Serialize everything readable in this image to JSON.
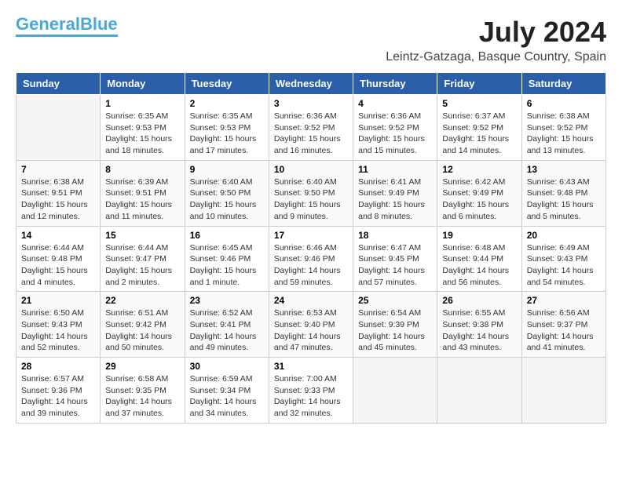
{
  "header": {
    "logo_line1": "General",
    "logo_line2": "Blue",
    "month_year": "July 2024",
    "location": "Leintz-Gatzaga, Basque Country, Spain"
  },
  "columns": [
    "Sunday",
    "Monday",
    "Tuesday",
    "Wednesday",
    "Thursday",
    "Friday",
    "Saturday"
  ],
  "weeks": [
    [
      {
        "day": "",
        "info": ""
      },
      {
        "day": "1",
        "info": "Sunrise: 6:35 AM\nSunset: 9:53 PM\nDaylight: 15 hours\nand 18 minutes."
      },
      {
        "day": "2",
        "info": "Sunrise: 6:35 AM\nSunset: 9:53 PM\nDaylight: 15 hours\nand 17 minutes."
      },
      {
        "day": "3",
        "info": "Sunrise: 6:36 AM\nSunset: 9:52 PM\nDaylight: 15 hours\nand 16 minutes."
      },
      {
        "day": "4",
        "info": "Sunrise: 6:36 AM\nSunset: 9:52 PM\nDaylight: 15 hours\nand 15 minutes."
      },
      {
        "day": "5",
        "info": "Sunrise: 6:37 AM\nSunset: 9:52 PM\nDaylight: 15 hours\nand 14 minutes."
      },
      {
        "day": "6",
        "info": "Sunrise: 6:38 AM\nSunset: 9:52 PM\nDaylight: 15 hours\nand 13 minutes."
      }
    ],
    [
      {
        "day": "7",
        "info": "Sunrise: 6:38 AM\nSunset: 9:51 PM\nDaylight: 15 hours\nand 12 minutes."
      },
      {
        "day": "8",
        "info": "Sunrise: 6:39 AM\nSunset: 9:51 PM\nDaylight: 15 hours\nand 11 minutes."
      },
      {
        "day": "9",
        "info": "Sunrise: 6:40 AM\nSunset: 9:50 PM\nDaylight: 15 hours\nand 10 minutes."
      },
      {
        "day": "10",
        "info": "Sunrise: 6:40 AM\nSunset: 9:50 PM\nDaylight: 15 hours\nand 9 minutes."
      },
      {
        "day": "11",
        "info": "Sunrise: 6:41 AM\nSunset: 9:49 PM\nDaylight: 15 hours\nand 8 minutes."
      },
      {
        "day": "12",
        "info": "Sunrise: 6:42 AM\nSunset: 9:49 PM\nDaylight: 15 hours\nand 6 minutes."
      },
      {
        "day": "13",
        "info": "Sunrise: 6:43 AM\nSunset: 9:48 PM\nDaylight: 15 hours\nand 5 minutes."
      }
    ],
    [
      {
        "day": "14",
        "info": "Sunrise: 6:44 AM\nSunset: 9:48 PM\nDaylight: 15 hours\nand 4 minutes."
      },
      {
        "day": "15",
        "info": "Sunrise: 6:44 AM\nSunset: 9:47 PM\nDaylight: 15 hours\nand 2 minutes."
      },
      {
        "day": "16",
        "info": "Sunrise: 6:45 AM\nSunset: 9:46 PM\nDaylight: 15 hours\nand 1 minute."
      },
      {
        "day": "17",
        "info": "Sunrise: 6:46 AM\nSunset: 9:46 PM\nDaylight: 14 hours\nand 59 minutes."
      },
      {
        "day": "18",
        "info": "Sunrise: 6:47 AM\nSunset: 9:45 PM\nDaylight: 14 hours\nand 57 minutes."
      },
      {
        "day": "19",
        "info": "Sunrise: 6:48 AM\nSunset: 9:44 PM\nDaylight: 14 hours\nand 56 minutes."
      },
      {
        "day": "20",
        "info": "Sunrise: 6:49 AM\nSunset: 9:43 PM\nDaylight: 14 hours\nand 54 minutes."
      }
    ],
    [
      {
        "day": "21",
        "info": "Sunrise: 6:50 AM\nSunset: 9:43 PM\nDaylight: 14 hours\nand 52 minutes."
      },
      {
        "day": "22",
        "info": "Sunrise: 6:51 AM\nSunset: 9:42 PM\nDaylight: 14 hours\nand 50 minutes."
      },
      {
        "day": "23",
        "info": "Sunrise: 6:52 AM\nSunset: 9:41 PM\nDaylight: 14 hours\nand 49 minutes."
      },
      {
        "day": "24",
        "info": "Sunrise: 6:53 AM\nSunset: 9:40 PM\nDaylight: 14 hours\nand 47 minutes."
      },
      {
        "day": "25",
        "info": "Sunrise: 6:54 AM\nSunset: 9:39 PM\nDaylight: 14 hours\nand 45 minutes."
      },
      {
        "day": "26",
        "info": "Sunrise: 6:55 AM\nSunset: 9:38 PM\nDaylight: 14 hours\nand 43 minutes."
      },
      {
        "day": "27",
        "info": "Sunrise: 6:56 AM\nSunset: 9:37 PM\nDaylight: 14 hours\nand 41 minutes."
      }
    ],
    [
      {
        "day": "28",
        "info": "Sunrise: 6:57 AM\nSunset: 9:36 PM\nDaylight: 14 hours\nand 39 minutes."
      },
      {
        "day": "29",
        "info": "Sunrise: 6:58 AM\nSunset: 9:35 PM\nDaylight: 14 hours\nand 37 minutes."
      },
      {
        "day": "30",
        "info": "Sunrise: 6:59 AM\nSunset: 9:34 PM\nDaylight: 14 hours\nand 34 minutes."
      },
      {
        "day": "31",
        "info": "Sunrise: 7:00 AM\nSunset: 9:33 PM\nDaylight: 14 hours\nand 32 minutes."
      },
      {
        "day": "",
        "info": ""
      },
      {
        "day": "",
        "info": ""
      },
      {
        "day": "",
        "info": ""
      }
    ]
  ]
}
